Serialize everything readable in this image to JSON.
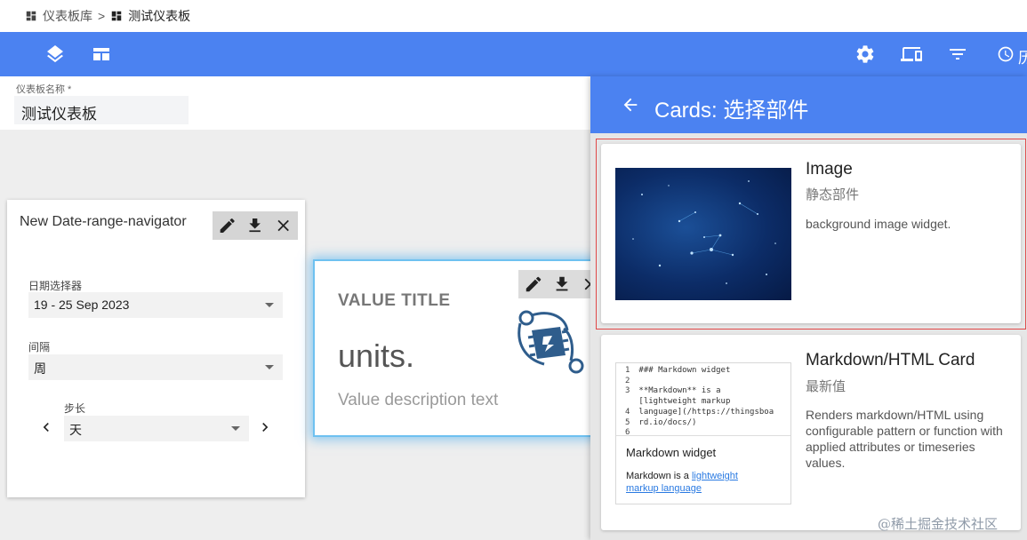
{
  "breadcrumb": {
    "parent": "仪表板库",
    "separator": ">",
    "current": "测试仪表板"
  },
  "toolbar": {
    "left_icons": [
      "layers-icon",
      "layout-icon"
    ],
    "right_icons": [
      "gear-icon",
      "devices-icon",
      "filter-icon",
      "clock-icon"
    ],
    "clock_label_partial": "历"
  },
  "dashboard_title": {
    "label": "仪表板名称 *",
    "value": "测试仪表板"
  },
  "date_widget": {
    "title": "New Date-range-navigator",
    "actions": [
      "edit-icon",
      "download-icon",
      "close-icon"
    ],
    "date_picker_label": "日期选择器",
    "date_picker_value": "19 - 25 Sep 2023",
    "interval_label": "间隔",
    "interval_value": "周",
    "step_label": "步长",
    "step_value": "天"
  },
  "value_widget": {
    "title": "VALUE TITLE",
    "units": "units.",
    "description": "Value description text",
    "actions": [
      "edit-icon",
      "download-icon",
      "close-icon"
    ]
  },
  "panel": {
    "title": "Cards: 选择部件",
    "cards": [
      {
        "name": "Image",
        "subtitle": "静态部件",
        "description": "background image widget."
      },
      {
        "name": "Markdown/HTML Card",
        "subtitle": "最新值",
        "description": "Renders markdown/HTML using configurable pattern or function with applied attributes or timeseries values.",
        "preview": {
          "code_lines": [
            {
              "num": "1",
              "text": "### Markdown widget"
            },
            {
              "num": "2",
              "text": ""
            },
            {
              "num": "3",
              "text": "**Markdown** is a"
            },
            {
              "num": "",
              "text": "[lightweight markup"
            },
            {
              "num": "4",
              "text": "language](/https://thingsboa"
            },
            {
              "num": "5",
              "text": "rd.io/docs/)"
            },
            {
              "num": "6",
              "text": ""
            }
          ],
          "heading": "Markdown widget",
          "text_bold": "Markdown",
          "text_plain": " is a ",
          "link_1": "lightweight",
          "link_2": "markup language"
        }
      }
    ]
  },
  "watermark": "@稀土掘金技术社区",
  "colors": {
    "primary": "#4b82f1",
    "selected_outline": "#e04848",
    "link": "#2a7ae2"
  }
}
